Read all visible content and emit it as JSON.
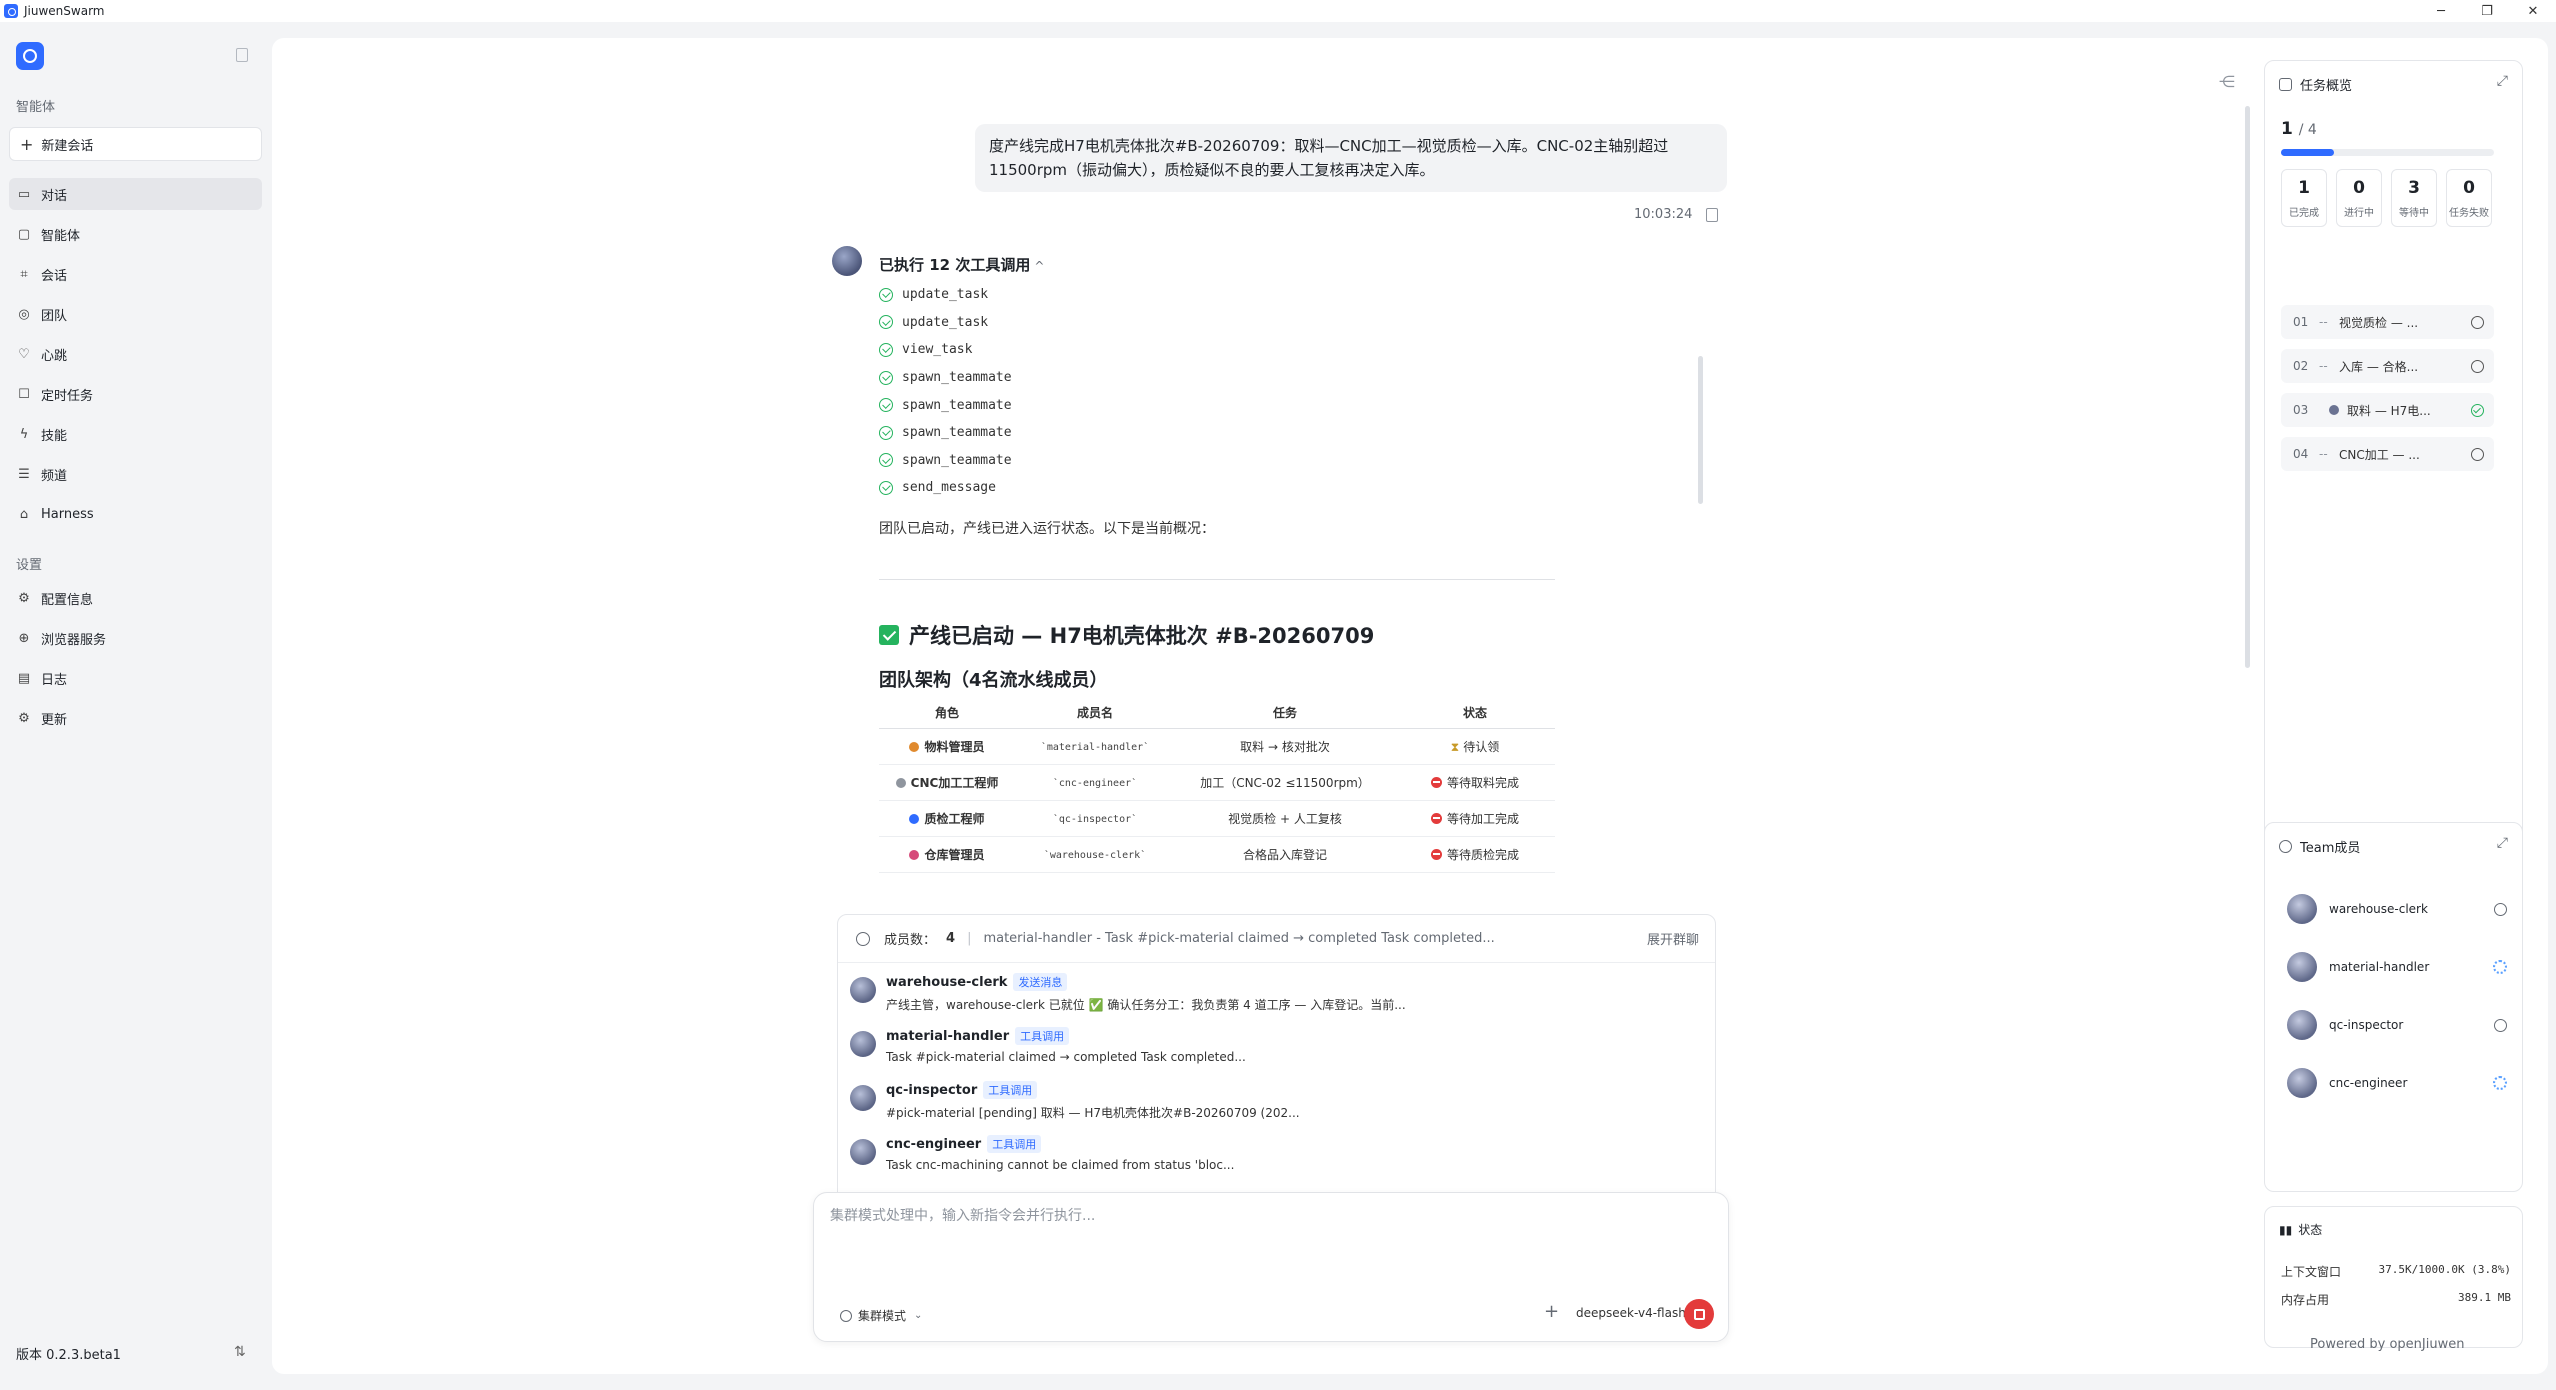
{
  "window": {
    "title": "JiuwenSwarm",
    "controls": [
      "─",
      "❐",
      "✕"
    ]
  },
  "sidebar": {
    "section_agents": "智能体",
    "new_chat": "新建会话",
    "nav": [
      {
        "label": "对话",
        "icon": "chat-icon",
        "active": true
      },
      {
        "label": "智能体",
        "icon": "agent-icon"
      },
      {
        "label": "会话",
        "icon": "session-icon"
      },
      {
        "label": "团队",
        "icon": "team-icon"
      },
      {
        "label": "心跳",
        "icon": "heartbeat-icon"
      },
      {
        "label": "定时任务",
        "icon": "schedule-icon"
      },
      {
        "label": "技能",
        "icon": "skill-icon"
      },
      {
        "label": "频道",
        "icon": "channel-icon"
      },
      {
        "label": "Harness",
        "icon": "harness-icon"
      }
    ],
    "section_settings": "设置",
    "settings_nav": [
      {
        "label": "配置信息",
        "icon": "config-icon"
      },
      {
        "label": "浏览器服务",
        "icon": "browser-icon"
      },
      {
        "label": "日志",
        "icon": "log-icon"
      },
      {
        "label": "更新",
        "icon": "update-icon"
      }
    ],
    "version": "版本 0.2.3.beta1"
  },
  "chat": {
    "user_message": "度产线完成H7电机壳体批次#B-20260709：取料—CNC加工—视觉质检—入库。CNC-02主轴别超过11500rpm（振动偏大），质检疑似不良的要人工复核再决定入库。",
    "time": "10:03:24",
    "tools_header": "已执行 12 次工具调用",
    "tools": [
      "update_task",
      "update_task",
      "view_task",
      "spawn_teammate",
      "spawn_teammate",
      "spawn_teammate",
      "spawn_teammate",
      "send_message"
    ],
    "status_line": "团队已启动，产线已进入运行状态。以下是当前概况：",
    "launch_title": "产线已启动 — H7电机壳体批次 #B-20260709",
    "team_title": "团队架构（4名流水线成员）",
    "table": {
      "headers": [
        "角色",
        "成员名",
        "任务",
        "状态"
      ],
      "rows": [
        {
          "role": "物料管理员",
          "member": "`material-handler`",
          "task": "取料 → 核对批次",
          "status": "待认领",
          "status_type": "waiting",
          "role_color": "#e08a2e"
        },
        {
          "role": "CNC加工工程师",
          "member": "`cnc-engineer`",
          "task": "加工（CNC-02 ≤11500rpm）",
          "status": "等待取料完成",
          "status_type": "blocked",
          "role_color": "#8f959e"
        },
        {
          "role": "质检工程师",
          "member": "`qc-inspector`",
          "task": "视觉质检 + 人工复核",
          "status": "等待加工完成",
          "status_type": "blocked",
          "role_color": "#2f6bff"
        },
        {
          "role": "仓库管理员",
          "member": "`warehouse-clerk`",
          "task": "合格品入库登记",
          "status": "等待质检完成",
          "status_type": "blocked",
          "role_color": "#d64a7a"
        }
      ]
    }
  },
  "feed": {
    "count_label": "成员数：",
    "count": "4",
    "separator": "|",
    "latest": "material-handler - Task #pick-material claimed → completed Task completed...",
    "expand": "展开群聊",
    "items": [
      {
        "name": "warehouse-clerk",
        "tag": "发送消息",
        "text": "产线主管，warehouse-clerk 已就位 ✅ 确认任务分工：我负责第 4 道工序 — 入库登记。当前..."
      },
      {
        "name": "material-handler",
        "tag": "工具调用",
        "text": "Task #pick-material claimed → completed Task completed..."
      },
      {
        "name": "qc-inspector",
        "tag": "工具调用",
        "text": "#pick-material [pending] 取料 — H7电机壳体批次#B-20260709 (202..."
      },
      {
        "name": "cnc-engineer",
        "tag": "工具调用",
        "text": "Task cnc-machining cannot be claimed from status 'bloc..."
      }
    ]
  },
  "composer": {
    "placeholder": "集群模式处理中，输入新指令会并行执行...",
    "mode": "集群模式",
    "add": "+",
    "model": "deepseek-v4-flash"
  },
  "tasks_panel": {
    "title": "任务概览",
    "done": "1",
    "total": "/ 4",
    "progress": 0.25,
    "stats": [
      {
        "value": "1",
        "label": "已完成"
      },
      {
        "value": "0",
        "label": "进行中"
      },
      {
        "value": "3",
        "label": "等待中"
      },
      {
        "value": "0",
        "label": "任务失败"
      }
    ],
    "tasks": [
      {
        "num": "01",
        "dash": "--",
        "name": "视觉质检 — ...",
        "state": "pending"
      },
      {
        "num": "02",
        "dash": "--",
        "name": "入库 — 合格...",
        "state": "pending"
      },
      {
        "num": "03",
        "dash": "",
        "name": "取料 — H7电...",
        "state": "done"
      },
      {
        "num": "04",
        "dash": "--",
        "name": "CNC加工 — ...",
        "state": "pending"
      }
    ]
  },
  "team_panel": {
    "title": "Team成员",
    "members": [
      {
        "name": "warehouse-clerk",
        "state": "idle"
      },
      {
        "name": "material-handler",
        "state": "working"
      },
      {
        "name": "qc-inspector",
        "state": "idle"
      },
      {
        "name": "cnc-engineer",
        "state": "working"
      }
    ]
  },
  "status_panel": {
    "title": "状态",
    "context_label": "上下文窗口",
    "context_value": "37.5K/1000.0K (3.8%)",
    "memory_label": "内存占用",
    "memory_value": "389.1 MB"
  },
  "footer": "Powered by openJiuwen",
  "colors": {
    "accent": "#2f6bff",
    "success": "#25b35e",
    "danger": "#e33b3b"
  }
}
